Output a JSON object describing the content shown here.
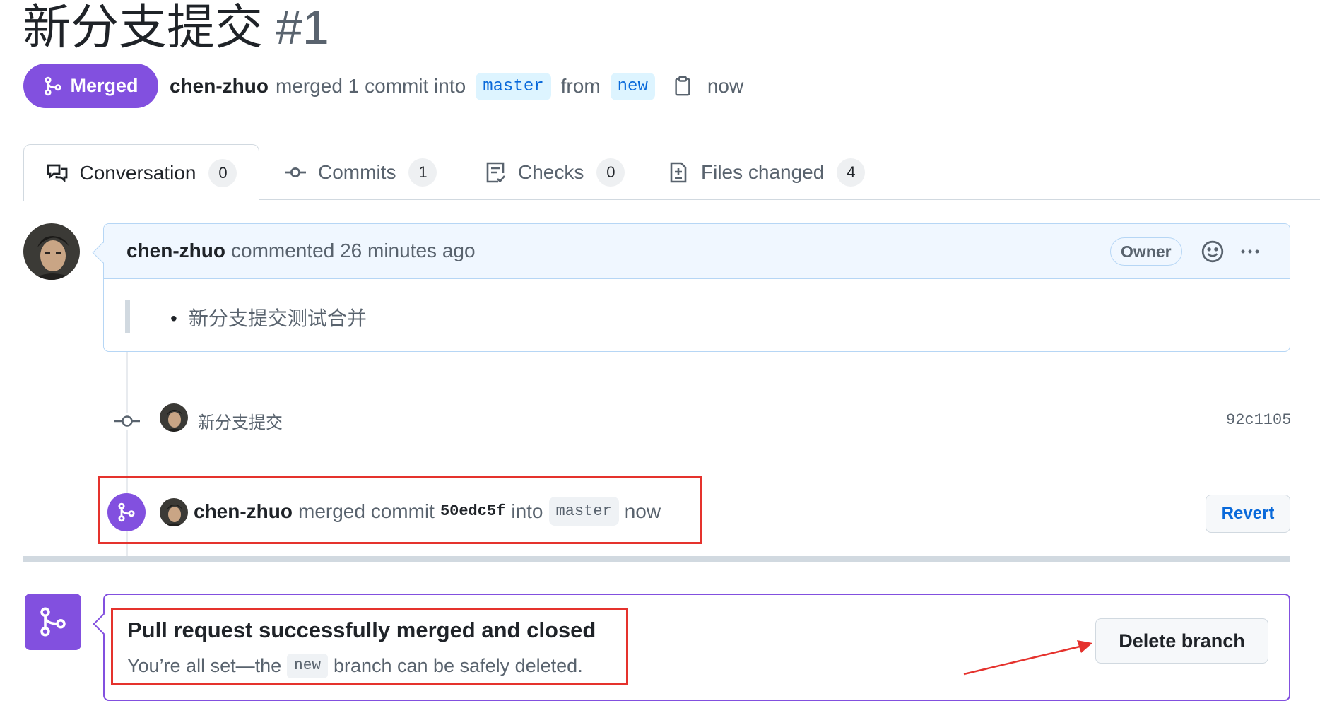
{
  "pr": {
    "title": "新分支提交",
    "number": "#1",
    "status": "Merged",
    "meta": {
      "author": "chen-zhuo",
      "text1": "merged 1 commit into",
      "base_branch": "master",
      "text2": "from",
      "head_branch": "new",
      "time": "now"
    }
  },
  "tabs": [
    {
      "label": "Conversation",
      "count": "0"
    },
    {
      "label": "Commits",
      "count": "1"
    },
    {
      "label": "Checks",
      "count": "0"
    },
    {
      "label": "Files changed",
      "count": "4"
    }
  ],
  "comment": {
    "author": "chen-zhuo",
    "action": "commented 26 minutes ago",
    "badge": "Owner",
    "body_item": "新分支提交测试合并"
  },
  "commit": {
    "message": "新分支提交",
    "sha": "92c1105"
  },
  "merge_event": {
    "author": "chen-zhuo",
    "text1": "merged commit",
    "sha": "50edc5f",
    "text2": "into",
    "branch": "master",
    "time": "now",
    "revert_label": "Revert"
  },
  "merge_box": {
    "heading": "Pull request successfully merged and closed",
    "sub_prefix": "You’re all set—the",
    "sub_branch": "new",
    "sub_suffix": "branch can be safely deleted.",
    "delete_label": "Delete branch"
  },
  "colors": {
    "merged_purple": "#8250df",
    "link_blue": "#0969da",
    "annotation_red": "#e5322d"
  }
}
